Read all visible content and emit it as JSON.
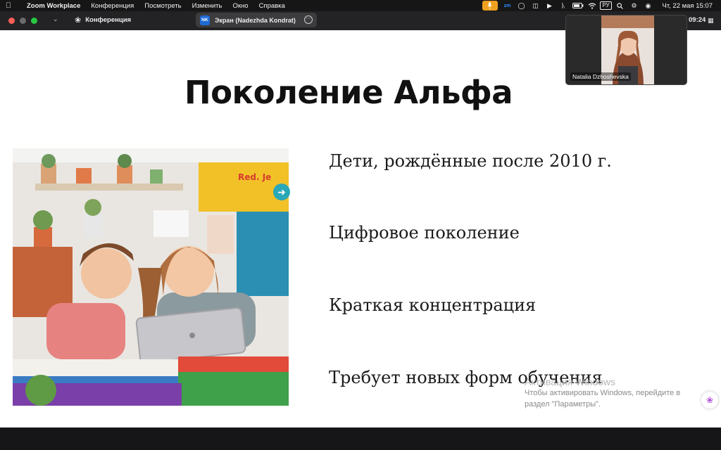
{
  "menubar": {
    "app_name": "Zoom Workplace",
    "menus": [
      "Конференция",
      "Посмотреть",
      "Изменить",
      "Окно",
      "Справка"
    ],
    "tray": {
      "zoom_badge": "zm",
      "language": "РУ",
      "datetime": "Чт, 22 мая  15:07"
    }
  },
  "zoombar": {
    "meeting_label": "Конференция",
    "share_label": "Экран (Nadezhda Kondrat)",
    "share_badge": "NK",
    "timer": "09:24"
  },
  "slide": {
    "title": "Поколение Альфа",
    "bullets": [
      "Дети, рождённые после 2010 г.",
      "Цифровое поколение",
      "Краткая концентрация",
      "Требует новых форм обучения"
    ],
    "image_logo": "Red. Je"
  },
  "watermark": {
    "title": "Активация Windows",
    "line1": "Чтобы активировать Windows, перейдите в",
    "line2": "раздел \"Параметры\"."
  },
  "participant": {
    "name": "Natalia Dzhoshevska"
  },
  "icons": {
    "apple": "apple-icon",
    "mic": "microphone-icon",
    "zoom": "zoom-icon",
    "wifi": "wifi-icon",
    "search": "search-icon",
    "battery": "battery-icon",
    "bluetooth": "bluetooth-icon",
    "next_slide": "arrow-right-icon",
    "copilot": "brain-icon",
    "share_options": "more-options-icon"
  },
  "colors": {
    "accent_mic": "#f0a020",
    "share_badge": "#1e6bd6",
    "nav_arrow": "#2ba8b8",
    "close": "#ff5f57",
    "maximize": "#28c840"
  }
}
